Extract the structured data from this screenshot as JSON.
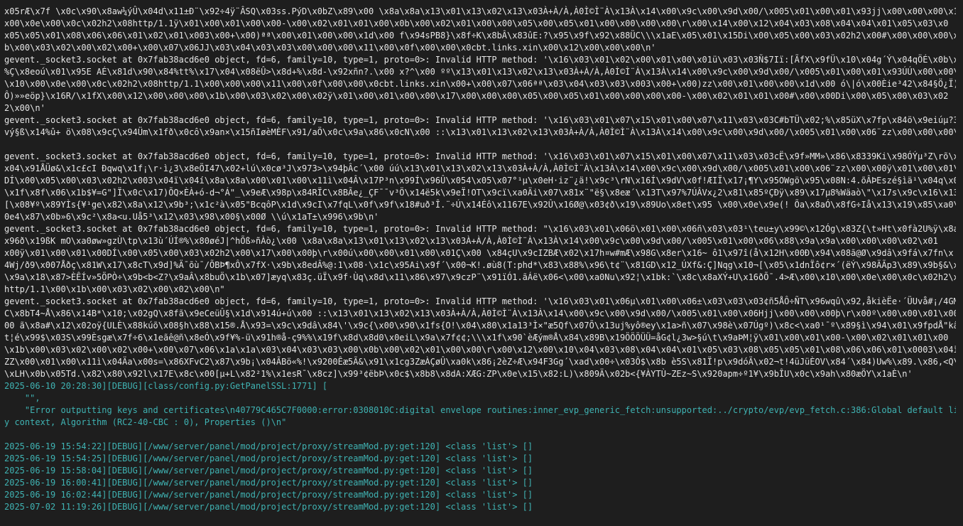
{
  "terminal": {
    "raw_lines": [
      "x05rÆ\\x7f \\x0c\\x90\\x8aw¼ýÛ\\x04d\\x11±Ð¨\\x92÷4ÿ¨ÂSQ\\x03ss.PýD\\x0bZ\\x89\\x00 \\x8a\\x8a\\x13\\x01\\x13\\x02\\x13\\x03À+À/À,À0Ì©Ì¨À\\x13À\\x14\\x00\\x9c\\x00\\x9d\\x00/\\x005\\x01\\x00\\x01\\x93jj\\x00\\x00\\x00\\x10",
      "x00\\x0e\\x00\\x0c\\x02h2\\x08http/1.1ÿ\\x01\\x00\\x01\\x00\\x00-\\x00\\x02\\x01\\x01\\x00\\x0b\\x00\\x02\\x01\\x00\\x00\\x05\\x00\\x05\\x01\\x00\\x00\\x00\\x00\\r\\x00\\x14\\x00\\x12\\x04\\x03\\x08\\x04\\x04\\x01\\x05\\x03\\x0",
      "x05\\x05\\x01\\x08\\x06\\x06\\x01\\x02\\x01\\x003\\x00+\\x00)ªª\\x00\\x01\\x00\\x00\\x1d\\x00 f\\x94sPB8}\\x8f÷K\\x8bÂ\\x83ûE:?\\x95\\x9f\\x92\\x88ÜC\\\\\\x1aE\\x05\\x01\\x15Di\\x00\\x05\\x00\\x03\\x02h2\\x00#\\x00\\x00\\x00\\x",
      "b\\x00\\x03\\x02\\x00\\x02\\x00+\\x00\\x07\\x06JJ\\x03\\x04\\x03\\x03\\x00\\x00\\x00\\x11\\x00\\x0f\\x00\\x00\\x0cbt.links.xin\\x00\\x12\\x00\\x00\\x00\\n'",
      "gevent._socket3.socket at 0x7fab38acd6e0 object, fd=6, family=10, type=1, proto=0>: Invalid HTTP method: '\\x16\\x03\\x01\\x02\\x00\\x01\\x00\\x01ü\\x03\\x03Ñ$7Iï:[ÃfX\\x9fÜ\\x10\\x04g´Ý\\x04qÖÉ\\x0b\\x85",
      "%Ç\\x8eoú\\x01\\x95E AÉ\\x81d\\x90\\x84%tt%\\x17\\x04\\x08ëÛ>\\x8d+%\\x8d-\\x92xñn?.\\x00 x?^\\x00 ºº\\x13\\x01\\x13\\x02\\x13\\x03À+À/À,À0Ì©Ì¨À\\x13À\\x14\\x00\\x9c\\x00\\x9d\\x00/\\x005\\x01\\x00\\x01\\x93ÚÚ\\x00\\x00\\x0",
      "\\x10\\x00\\x0e\\x00\\x0c\\x02h2\\x08http/1.1\\x00\\x00\\x00\\x11\\x00\\x0f\\x00\\x00\\x0cbt.links.xin\\x00+\\x00\\x07\\x06ªª\\x03\\x04\\x03\\x03\\x003\\x00+\\x00)zz\\x00\\x01\\x00\\x00\\x1d\\x00 ó\\|ó\\x00Èie³42\\x84§Ö¿Ï)y»",
      "Ô)»»eöp}\\x16R/\\x1fX\\x00\\x12\\x00\\x00\\x00\\x1b\\x00\\x03\\x02\\x00\\x02ÿ\\x01\\x00\\x01\\x00\\x00\\x17\\x00\\x00\\x00\\x05\\x00\\x05\\x01\\x00\\x00\\x00\\x00-\\x00\\x02\\x01\\x01\\x00#\\x00\\x00Di\\x00\\x05\\x00\\x03\\x02",
      "2\\x00\\n'",
      "gevent._socket3.socket at 0x7fab38acd6e0 object, fd=6, family=10, type=1, proto=0>: Invalid HTTP method: '\\x16\\x03\\x01\\x07\\x15\\x01\\x00\\x07\\x11\\x03\\x03C#bTÜ\\x02;%\\x85üX\\x7fp\\x84ö\\x9eiúµ?3u$",
      "vý§ß\\x14%û+ ö\\x08\\x9cÇ\\x94Üm\\x1fð\\x0cô\\x9an×\\x15ñIøèMÈF\\x91/aÖ\\x0c\\x9a\\x86\\x0cN\\x00 ::\\x13\\x01\\x13\\x02\\x13\\x03À+À/À,À0Ì©Ì¨À\\x13À\\x14\\x00\\x9c\\x00\\x9d\\x00/\\x005\\x01\\x00\\x06¨zz\\x00\\x00\\x00\\x",
      "",
      "gevent._socket3.socket at 0x7fab38acd6e0 object, fd=6, family=10, type=1, proto=0>: Invalid HTTP method: '\\x16\\x03\\x01\\x07\\x15\\x01\\x00\\x07\\x11\\x03\\x03cË\\x9f»MM»\\x86\\x8339Ki\\x98ÓÝµ³Z\\rõ\\x0c",
      "x04\\x91ÅÜø&\\x1c£cI Ðqwq\\x1f¡\\r·ì¿3\\x8eÖI47\\x02+lú\\x0cø³J\\x973>\\x94þÂc´\\x00 úú\\x13\\x01\\x13\\x02\\x13\\x03À+À/À,À0Ì©Ì¨À\\x13À\\x14\\x00\\x9c\\x00\\x9d\\x00/\\x005\\x01\\x00\\x06¨zz\\x00\\x00ÿ\\x01\\x00\\x01\\x0",
      "DÍ\\x00\\x05\\x00\\x03\\x02h2\\x003\\x04ï\\x04í\\x8a\\x8a\\x00\\x01\\x00\\x11ì\\x04Â\\x17P³n\\x99Í\\x96Û\\x054\\x05\\x07°¹µ\\x0eH·iz¨¿ä!\\x9c³\\rN\\x16Í\\x9dV\\x0f!ÆIÏ\\x17¡¶Y\\x95OWgö\\x95\\x08N:4.õÂÞEszé§ìä¹\\x04q\\x04:",
      "\\x1f\\x8f\\x06\\x1b$¥=G\"]Ï\\x0c\\x17)ÕQ×ÈÀ+ó-d¬°Á\"_\\x9eÆ\\x98p\\x84RÏC\\x8BÃe¿_ÇF¯¯v³Ö\\x14ë5k\\x9eÏ!OT\\x9cï\\xa0Äi\\x07\\x81x¨\"ë§\\x8eæ´\\x13T\\x97%7ÚÂVx¿2\\x81\\x85ºÇÐÿ\\x89\\x17µ8%Wäaò\\\"\\x17s\\x9c\\x16\\x13_",
      "[\\x08¥º\\x89YÌs{¥¹ge\\x82\\x8a\\x12\\x9b³;\\x1c²à\\x05\"BcqôP\\x1d\\x9cI\\x7fqL\\x0f\\x9f\\x18#uð³Î.¨÷Ú\\x14Éô\\x1167E\\x92Û\\x16Ø@\\x03¢ð\\x19\\x89Uo\\x8et\\x95 \\x00\\x0e\\x9e(! Õa\\x8aÓ\\x8fG÷Iå\\x13\\x19\\x85\\xa0\\x00",
      "0e4\\x87\\x0b»6\\x9c²\\x8a<u.Uå5³\\x12\\x03\\x98\\x00§\\x00Ø \\\\ú\\x1aT±\\x996\\x9b\\n'",
      "gevent._socket3.socket at 0x7fab38acd6e0 object, fd=6, family=10, type=1, proto=0>: Invalid HTTP method: \"\\x16\\x03\\x01\\x06õ\\x01\\x00\\x06ñ\\x03\\x03¹\\teu±y\\x99©\\x12Óg\\x83Z{\\t»Ht\\x0fà2U%ÿ\\x8aÎ³",
      "x96ð\\x19ßK mO\\xa0øw»gzÙ\\tp\\x13ù´ÚÍ®%\\x80øéJ|^hÕß»ñÀò¿\\x00 \\x8a\\x8a\\x13\\x01\\x13\\x02\\x13\\x03À+À/À,À0Ì©Ì¨À\\x13À\\x14\\x00\\x9c\\x00\\x9d\\x00/\\x005\\x01\\x00\\x06\\x88\\x9a\\x9a\\x00\\x00\\x00\\x02\\x01",
      "x00ÿ\\x01\\x00\\x01\\x00DÍ\\x00\\x05\\x00\\x03\\x02h2\\x00\\x17\\x00\\x00þ\\r\\x00ú\\x00\\x00\\x01\\x00\\x01Ç\\x00 \\x84çU\\x9cIZBÆ\\x02\\x17h¤w#mÆ\\x98G\\x8er\\x16~ ô1\\x97î(å\\x12H\\x00Ð\\x94\\x08ã@Ø\\x9dâ\\x9fá\\x7fn\\x",
      "4Wj/ð9\\x007Åðç\\x81W\\x17\\x8cT\\x9d]%Ä¯õù¯/ÕBÞ¶xÔ\\x7fX·\\x9b\\x8edÂ%@:1\\x08·\\x1c\\x95Ai\\x9f´\\x00¬K!.øù8(T:phd*\\x83\\x88%\\x96\\t¢¨\\x81GD\\x12_ÚXf&:Ç]Nqg\\x10¬[\\x05\\x1dnÏô¢r×´(ëÝ\\x98ÄÃp3\\x89\\x9b§&\\x9e",
      "\\x9a\\x18\\x87>ÈÊÍv»5ÖPÒ÷\\x9b<b<Z?\\x9aÂ\\x8buÖ\\x1b\\x07]æyq\\x83ç.üÏ\\x9f·Ùq\\x8d\\x11\\x86\\x97\\x9czP¨\\x91ïÓ1.ãÁë\\x06<\\x00\\xa0Nu\\x92¦\\x1bk:`\\x8c\\x8aXÝ+U\\x16ðÕ¯.4>Æ\\x00\\x10\\x00\\x0e\\x00\\x0c\\x02h2\\x0",
      "http/1.1\\x00\\x1b\\x00\\x03\\x02\\x00\\x02\\x00\\n\"",
      "gevent._socket3.socket at 0x7fab38acd6e0 object, fd=6, family=10, type=1, proto=0>: Invalid HTTP method: '\\x16\\x03\\x01\\x06µ\\x01\\x00\\x06±\\x03\\x03\\x03¢ñ5ÅÔ÷ÑT\\x96wqû\\x92,åkièËe·´ÜUvå#¡/4GM l]\\x1",
      "C\\x8bT4~Å\\x86\\x14B*\\x10;\\x02gQ\\x8fã\\x9eCeüÛ§\\x1d\\x914ú+ú\\x00 ::\\x13\\x01\\x13\\x02\\x13\\x03À+À/À,À0Ì©Ì¨À\\x13À\\x14\\x00\\x9c\\x00\\x9d\\x00/\\x005\\x01\\x00\\x06Hjj\\x00\\x00\\x00þ\\r\\x00º\\x00\\x00\\x01\\x00\\x01Ù\\",
      "00 ã\\x8a#\\x12\\x02oÿ{ULÈ\\x88kúõ\\x08§h\\x88\\x15®.Å\\x93=\\x9c\\x9dâ\\x84\\'\\x9c{\\x00\\x90\\x1fs{O!\\x04\\x80\\x1a13³Ì×\"æ5Qf\\x07Õ\\x13uj%yô®ey\\x1a>ñ\\x07\\x98è\\x07Úgº)\\x8c<\\xa0¹¯º\\x89§ì\\x94\\x01\\x9fpdÅ\"kâð³",
      "t¦é\\x99$\\x03S\\x99Èsgæ\\x7f÷6\\x1eãê@ñ\\x8eÓ\\x9f¥%-ü\\x91h®å-ç9%%\\x19f\\x8d\\x8d0\\x0eiL\\x9a\\x7f¢¢;\\\\\\x1f\\x90`èÆým®Å\\x84\\x89B\\x19ÖÖÖÜÜ=åG¢l¿3w>§ú\\t\\x9aÞM¦ÿ\\x01\\x00\\x01\\x00-\\x00\\x02\\x01\\x01\\x00",
      "\\x1b\\x00\\x03\\x02\\x00\\x02\\x00+\\x00\\x07\\x06\\x1a\\x1a\\x03\\x04\\x03\\x03\\x00\\x0b\\x00\\x02\\x01\\x00\\x00\\r\\x00\\x12\\x00\\x10\\x04\\x03\\x08\\x04\\x04\\x01\\x05\\x03\\x08\\x05\\x05\\x01\\x08\\x06\\x06\\x01\\x0003\\x04ï\\x04",
      "ZZ\\x00\\x01\\x00\\x11ì\\x04Äa\\x00s=\\x86XFvC2\\x87\\x9b¡\\x04ÃBö«%!\\x9200Êæ5Ã&\\x91\\x1cg3ZæÀÇøÛ\\xa0k\\x86¡2èZ÷Æ\\x94F3Gg´\\xad\\x00÷\\x03Ô$\\x8b è5S\\x81Ï!p\\x9dóÄ\\x02¬t!4üJüÈOV\\x84´\\x84)Uw%\\x89.\\x86,<Q\\x8",
      "\\xLH\\x0b\\x05Td.\\x82\\x80\\x92l\\x17E\\x8c\\x00[µ+L\\x82²1%\\x1esR¯\\x8cz]\\x99³¢ëbÞ\\x0c$\\x8b8\\x8dA:XÆG:ZP\\x0e\\x15\\x82:L)\\x809Ä\\x02b<{¥ÀYTÙ~ZEz~S\\x920apm÷º1¥\\x9bÎU\\x0c\\x9ah\\x80æÖY\\x1aÈ\\n'"
    ],
    "debug_header": "2025-06-10 20:28:30][DEBUG][class/config.py:GetPanelSSL:1771] [",
    "json_lines": [
      "    \"\",",
      "    \"Error outputting keys and certificates\\n40779C465C7F0000:error:0308010C:digital envelope routines:inner_evp_generic_fetch:unsupported:../crypto/evp/evp_fetch.c:386:Global default libra",
      "y context, Algorithm (RC2-40-CBC : 0), Properties ()\\n\""
    ],
    "log_lines": [
      "2025-06-19 15:54:22][DEBUG][/www/server/panel/mod/project/proxy/streamMod.py:get:120] <class 'list'> []",
      "2025-06-19 15:54:25][DEBUG][/www/server/panel/mod/project/proxy/streamMod.py:get:120] <class 'list'> []",
      "2025-06-19 15:58:04][DEBUG][/www/server/panel/mod/project/proxy/streamMod.py:get:120] <class 'list'> []",
      "2025-06-19 16:00:41][DEBUG][/www/server/panel/mod/project/proxy/streamMod.py:get:120] <class 'list'> []",
      "2025-06-19 16:02:44][DEBUG][/www/server/panel/mod/project/proxy/streamMod.py:get:120] <class 'list'> []",
      "2025-07-02 11:19:26][DEBUG][/www/server/panel/mod/project/proxy/streamMod.py:get:120] <class 'list'> []"
    ]
  }
}
